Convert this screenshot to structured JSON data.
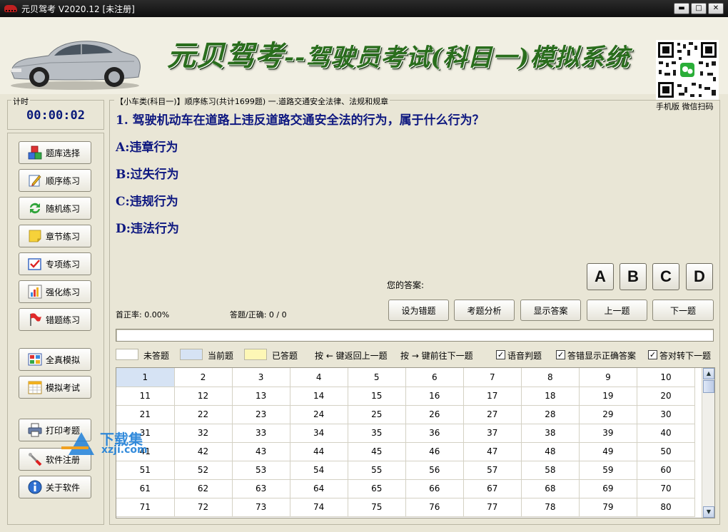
{
  "window": {
    "title": "元贝驾考 V2020.12 [未注册]",
    "min": "▬",
    "max": "□",
    "close": "✕"
  },
  "banner": {
    "title_main": "元贝驾考",
    "title_sub": "--驾驶员考试(科目一)模拟系统",
    "qr_caption": "手机版 微信扫码"
  },
  "timer": {
    "label": "计时",
    "value": "00:00:02"
  },
  "sidebar": {
    "items": [
      {
        "label": "题库选择",
        "icon": "cubes-icon"
      },
      {
        "label": "顺序练习",
        "icon": "pencil-icon"
      },
      {
        "label": "随机练习",
        "icon": "refresh-icon"
      },
      {
        "label": "章节练习",
        "icon": "note-icon"
      },
      {
        "label": "专项练习",
        "icon": "checkbox-icon"
      },
      {
        "label": "强化练习",
        "icon": "chart-icon"
      },
      {
        "label": "错题练习",
        "icon": "flag-icon"
      },
      {
        "label": "全真模拟",
        "icon": "grid-icon"
      },
      {
        "label": "模拟考试",
        "icon": "calendar-icon"
      },
      {
        "label": "打印考题",
        "icon": "printer-icon"
      },
      {
        "label": "软件注册",
        "icon": "wrench-icon"
      },
      {
        "label": "关于软件",
        "icon": "info-icon"
      }
    ]
  },
  "main": {
    "breadcrumb": "【小车类(科目一)】顺序练习(共计1699题) 一.道路交通安全法律、法规和规章",
    "question": "1. 驾驶机动车在道路上违反道路交通安全法的行为，属于什么行为？",
    "options": [
      "A:违章行为",
      "B:过失行为",
      "C:违规行为",
      "D:违法行为"
    ],
    "answer_label": "您的答案:",
    "answer_buttons": [
      "A",
      "B",
      "C",
      "D"
    ],
    "first_accuracy": "首正率: 0.00%",
    "answered_correct": "答题/正确: 0 / 0",
    "actions": [
      "设为错题",
      "考题分析",
      "显示答案",
      "上一题",
      "下一题"
    ],
    "progress_fraction": 0.0
  },
  "legend": {
    "unanswered": "未答题",
    "current": "当前题",
    "answered": "已答题",
    "hint_prev": "按 ← 键返回上一题",
    "hint_next": "按 → 键前往下一题",
    "voice": "语音判题",
    "show_correct": "答错显示正确答案",
    "auto_next": "答对转下一题",
    "check_mark": "✓"
  },
  "grid": {
    "rows": [
      [
        "1",
        "2",
        "3",
        "4",
        "5",
        "6",
        "7",
        "8",
        "9",
        "10"
      ],
      [
        "11",
        "12",
        "13",
        "14",
        "15",
        "16",
        "17",
        "18",
        "19",
        "20"
      ],
      [
        "21",
        "22",
        "23",
        "24",
        "25",
        "26",
        "27",
        "28",
        "29",
        "30"
      ],
      [
        "31",
        "32",
        "33",
        "34",
        "35",
        "36",
        "37",
        "38",
        "39",
        "40"
      ],
      [
        "41",
        "42",
        "43",
        "44",
        "45",
        "46",
        "47",
        "48",
        "49",
        "50"
      ],
      [
        "51",
        "52",
        "53",
        "54",
        "55",
        "56",
        "57",
        "58",
        "59",
        "60"
      ],
      [
        "61",
        "62",
        "63",
        "64",
        "65",
        "66",
        "67",
        "68",
        "69",
        "70"
      ],
      [
        "71",
        "72",
        "73",
        "74",
        "75",
        "76",
        "77",
        "78",
        "79",
        "80"
      ]
    ],
    "current_index": 0
  },
  "watermark": {
    "line1": "下载集",
    "line2": "xzji.com"
  }
}
